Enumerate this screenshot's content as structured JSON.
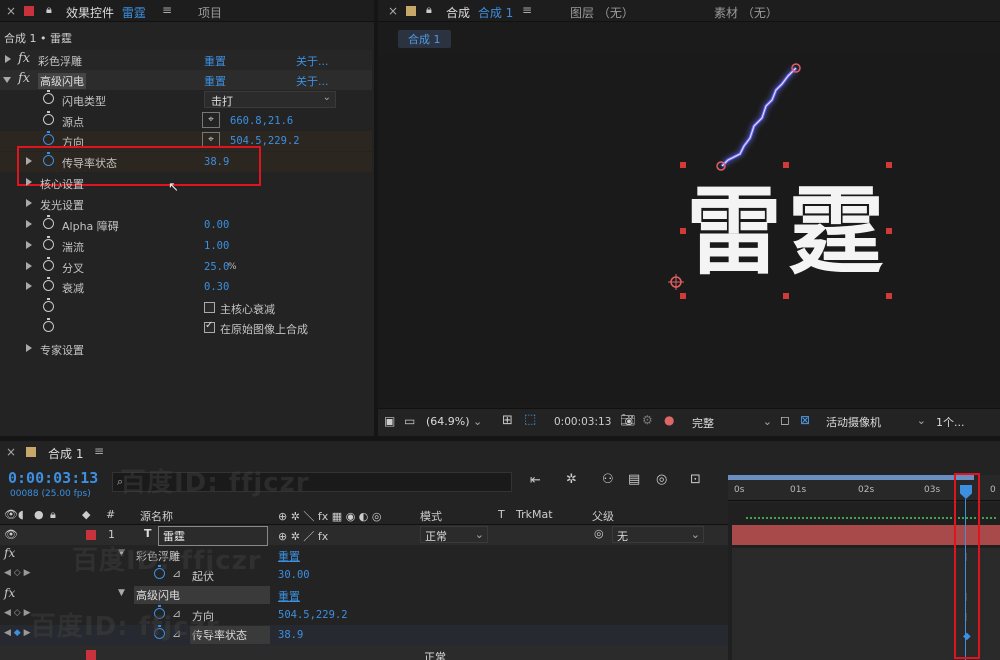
{
  "effect_controls": {
    "tab_title": "效果控件",
    "tab_target": "雷霆",
    "tab_project": "项目",
    "breadcrumb": "合成 1 • 雷霆",
    "effects": [
      {
        "fx": "fx",
        "name": "彩色浮雕",
        "reset": "重置",
        "about": "关于..."
      },
      {
        "fx": "fx",
        "name": "高级闪电",
        "reset": "重置",
        "about": "关于..."
      }
    ],
    "properties": {
      "lightning_type": {
        "label": "闪电类型",
        "value": "击打"
      },
      "origin": {
        "label": "源点",
        "value": "660.8,21.6"
      },
      "direction": {
        "label": "方向",
        "value": "504.5,229.2"
      },
      "conductivity": {
        "label": "传导率状态",
        "value": "38.9"
      },
      "core_settings": {
        "label": "核心设置"
      },
      "glow_settings": {
        "label": "发光设置"
      },
      "alpha_obstacle": {
        "label": "Alpha 障碍",
        "value": "0.00"
      },
      "turbulence": {
        "label": "湍流",
        "value": "1.00"
      },
      "forking": {
        "label": "分叉",
        "value": "25.0",
        "unit": "%"
      },
      "decay": {
        "label": "衰减",
        "value": "0.30"
      },
      "main_core_decay": {
        "label": "主核心衰减"
      },
      "composite_on_original": {
        "label": "在原始图像上合成"
      },
      "expert_settings": {
        "label": "专家设置"
      }
    }
  },
  "composition": {
    "tab_prefix": "合成",
    "tab_name": "合成 1",
    "layer_tab": "图层 （无）",
    "footage_tab": "素材 （无）",
    "subtab": "合成 1",
    "preview_text": "雷霆",
    "toolbar": {
      "zoom": "(64.9%)",
      "timecode": "0:00:03:13",
      "resolution": "完整",
      "camera": "活动摄像机",
      "views": "1个..."
    }
  },
  "timeline": {
    "tab": "合成 1",
    "timecode": "0:00:03:13",
    "frames": "00088 (25.00 fps)",
    "columns": {
      "source": "源名称",
      "mode": "模式",
      "t": "T",
      "trkmat": "TrkMat",
      "parent": "父级"
    },
    "layer": {
      "num": "1",
      "type": "T",
      "name": "雷霆",
      "mode": "正常",
      "parent": "无"
    },
    "sub_rows": [
      {
        "name": "彩色浮雕",
        "value": "重置"
      },
      {
        "name": "起伏",
        "value": "30.00"
      },
      {
        "name": "高级闪电",
        "value": "重置"
      },
      {
        "name": "方向",
        "value": "504.5,229.2"
      },
      {
        "name": "传导率状态",
        "value": "38.9"
      }
    ],
    "ruler": [
      "0s",
      "01s",
      "02s",
      "03s",
      "0"
    ],
    "bottom_mode": "正常"
  },
  "watermark": "百度ID: ffjczr",
  "colors": {
    "accent_blue": "#3d8fe0",
    "highlight_red": "#e0141e",
    "layer_bar": "#a84a4a"
  }
}
